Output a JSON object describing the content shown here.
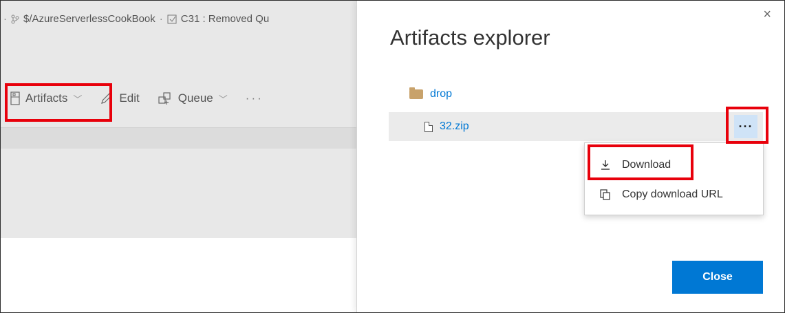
{
  "breadcrumb": {
    "repo": "$/AzureServerlessCookBook",
    "separator": "·",
    "changeset": "C31 : Removed Qu"
  },
  "toolbar": {
    "artifacts_label": "Artifacts",
    "edit_label": "Edit",
    "queue_label": "Queue",
    "more_label": "···"
  },
  "panel": {
    "title": "Artifacts explorer",
    "close_x": "×",
    "folder_name": "drop",
    "file_name": "32.zip",
    "file_more": "···",
    "close_button": "Close"
  },
  "context_menu": {
    "items": [
      {
        "label": "Download",
        "icon": "download-icon"
      },
      {
        "label": "Copy download URL",
        "icon": "copy-icon"
      }
    ]
  },
  "colors": {
    "accent": "#0078d4",
    "highlight": "#e8000b",
    "background_gray": "#e8e8e8",
    "selected_row": "#ebebeb",
    "button_hover": "#cfe3f7"
  }
}
